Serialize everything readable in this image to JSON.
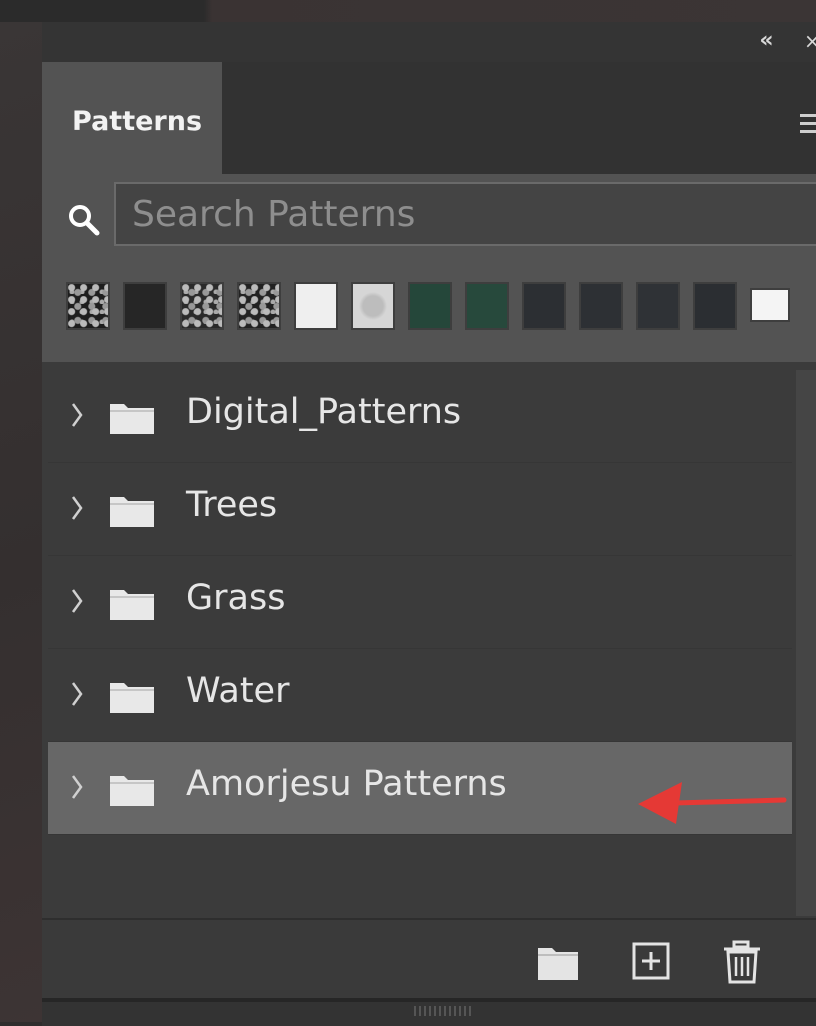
{
  "panel": {
    "tab_label": "Patterns",
    "collapse_glyph": "«",
    "close_glyph": "×"
  },
  "search": {
    "placeholder": "Search Patterns",
    "value": ""
  },
  "swatches": [
    {
      "name": "swatch-noise-1",
      "color": "#1e1e1e"
    },
    {
      "name": "swatch-dark-1",
      "color": "#262626"
    },
    {
      "name": "swatch-noise-2",
      "color": "#2a2a2a"
    },
    {
      "name": "swatch-noise-3",
      "color": "#222222"
    },
    {
      "name": "swatch-white",
      "color": "#efefef"
    },
    {
      "name": "swatch-light-gray",
      "color": "#d6d6d6"
    },
    {
      "name": "swatch-green-1",
      "color": "#25473a"
    },
    {
      "name": "swatch-green-2",
      "color": "#27493c"
    },
    {
      "name": "swatch-charcoal-1",
      "color": "#2c2f33"
    },
    {
      "name": "swatch-charcoal-2",
      "color": "#2d3034"
    },
    {
      "name": "swatch-charcoal-3",
      "color": "#2f3236"
    },
    {
      "name": "swatch-charcoal-4",
      "color": "#2b2e32"
    },
    {
      "name": "swatch-white-2",
      "color": "#f4f4f4"
    }
  ],
  "groups": [
    {
      "label": "Digital_Patterns",
      "selected": false
    },
    {
      "label": "Trees",
      "selected": false
    },
    {
      "label": "Grass",
      "selected": false
    },
    {
      "label": "Water",
      "selected": false
    },
    {
      "label": "Amorjesu Patterns",
      "selected": true
    }
  ],
  "footer": {
    "buttons": [
      "new-group-folder-icon",
      "new-pattern-icon",
      "trash-icon"
    ]
  },
  "colors": {
    "panel_bg": "#535353",
    "selected_row": "#676767",
    "annotation_arrow": "#e53935"
  }
}
